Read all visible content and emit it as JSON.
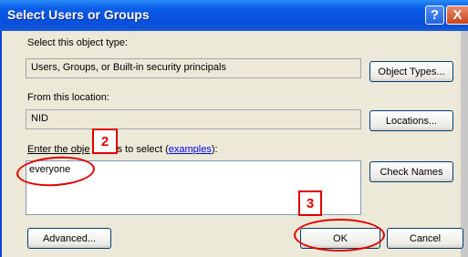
{
  "dialog": {
    "title": "Select Users or Groups",
    "help_glyph": "?",
    "close_glyph": "X"
  },
  "object_type": {
    "label": "Select this object type:",
    "value": "Users, Groups, or Built-in security principals",
    "button": "Object Types..."
  },
  "location": {
    "label": "From this location:",
    "value": "NID",
    "button": "Locations..."
  },
  "names": {
    "label_prefix": "Enter the obje",
    "label_middle": "s to select (",
    "link": "examples",
    "label_suffix": "):",
    "value": "everyone",
    "check_button": "Check Names"
  },
  "footer": {
    "advanced": "Advanced...",
    "ok": "OK",
    "cancel": "Cancel"
  },
  "annotations": {
    "step2": "2",
    "step3": "3",
    "color": "#e00000"
  }
}
